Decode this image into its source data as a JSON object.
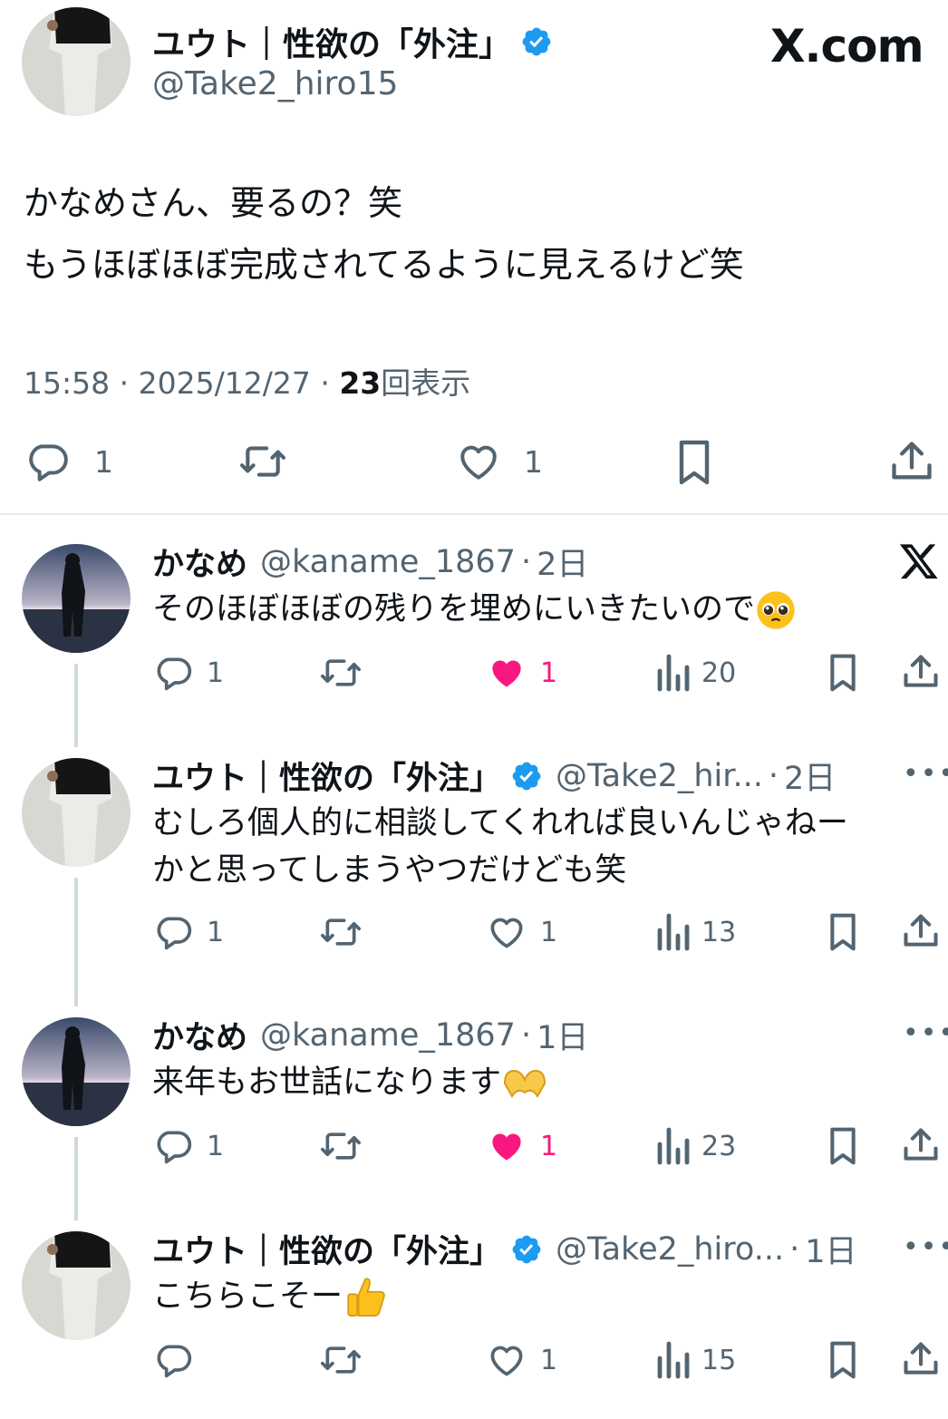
{
  "main": {
    "author_name": "ユウト｜性欲の「外注」",
    "author_handle": "@Take2_hiro15",
    "brand": "X.com",
    "text_lines": [
      "かなめさん、要るの？笑",
      "もうほぼほぼ完成されてるように見えるけど笑"
    ],
    "meta": {
      "time": "15:58",
      "date": "2025/12/27",
      "views": "23",
      "views_label": "回表示",
      "sep": "·"
    },
    "actions": {
      "reply_count": "1",
      "like_count": "1"
    }
  },
  "replies": [
    {
      "name": "かなめ",
      "handle": "@kaname_1867",
      "time": "2日",
      "text_lines": [
        "そのほぼほぼの残りを埋めにいきたいので"
      ],
      "reply_count": "1",
      "like_count": "1",
      "liked": true,
      "views": "20",
      "corner": "x-logo"
    },
    {
      "name": "ユウト｜性欲の「外注」",
      "handle": "@Take2_hir...",
      "time": "2日",
      "text_lines": [
        "むしろ個人的に相談してくれれば良いんじゃねー",
        "かと思ってしまうやつだけども笑"
      ],
      "reply_count": "1",
      "like_count": "1",
      "liked": false,
      "views": "13",
      "corner": "more"
    },
    {
      "name": "かなめ",
      "handle": "@kaname_1867",
      "time": "1日",
      "text_lines": [
        "来年もお世話になります"
      ],
      "reply_count": "1",
      "like_count": "1",
      "liked": true,
      "views": "23",
      "corner": "more"
    },
    {
      "name": "ユウト｜性欲の「外注」",
      "handle": "@Take2_hiro...",
      "time": "1日",
      "text_lines": [
        "こちらこそー"
      ],
      "reply_count": "",
      "like_count": "1",
      "liked": false,
      "views": "15",
      "corner": "more"
    }
  ],
  "icons": {
    "verified": "verified-badge-icon",
    "reply": "reply-icon",
    "retweet": "retweet-icon",
    "like": "heart-icon",
    "views": "views-chart-icon",
    "bookmark": "bookmark-icon",
    "share": "share-icon"
  },
  "colors": {
    "verified": "#1d9bf0",
    "liked": "#f91880",
    "muted": "#536471",
    "text": "#0f1419"
  },
  "more_glyph": "•••",
  "dot": "·"
}
